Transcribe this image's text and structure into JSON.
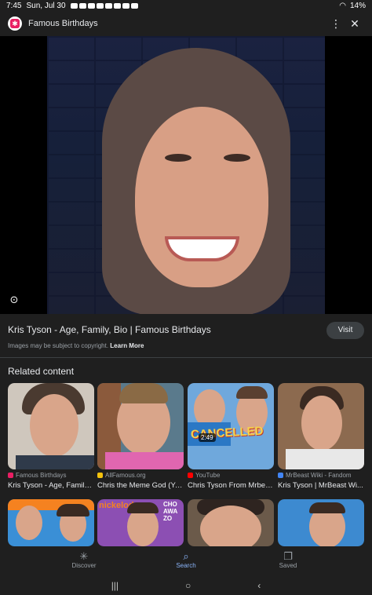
{
  "status_bar": {
    "time": "7:45",
    "date": "Sun, Jul 30",
    "battery": "14%"
  },
  "header": {
    "title": "Famous Birthdays",
    "favicon_glyph": "✱",
    "menu_icon": "⋮",
    "close_icon": "✕"
  },
  "result": {
    "title": "Kris Tyson - Age, Family, Bio | Famous Birthdays",
    "visit_label": "Visit",
    "copyright_text": "Images may be subject to copyright.",
    "learn_more": "Learn More"
  },
  "related": {
    "heading": "Related content",
    "cards": [
      {
        "source": "Famous Birthdays",
        "title": "Kris Tyson - Age, Family,...",
        "source_color": "#e91e63"
      },
      {
        "source": "AllFamous.org",
        "title": "Chris the Meme God (Yo...",
        "source_color": "#f4c20d"
      },
      {
        "source": "YouTube",
        "title": "Chris Tyson From Mrbea...",
        "source_color": "#ff0000",
        "duration": "2:49",
        "overlay_text": "CANCELLED"
      },
      {
        "source": "MrBeast Wiki - Fandom",
        "title": "Kris Tyson | MrBeast Wi...",
        "source_color": "#4285f4"
      },
      {
        "overlay_text": "nickelodeon"
      },
      {
        "overlay_text": "CHO AWA ZO"
      }
    ]
  },
  "bottom_nav": {
    "items": [
      {
        "label": "Discover",
        "icon": "✳"
      },
      {
        "label": "Search",
        "icon": "🔍"
      },
      {
        "label": "Saved",
        "icon": "❐"
      }
    ]
  },
  "system_nav": {
    "recents": "|||",
    "home": "○",
    "back": "‹"
  },
  "colors": {
    "background": "#1f1f1f",
    "accent": "#8ab4f8",
    "favicon": "#e91e63"
  }
}
